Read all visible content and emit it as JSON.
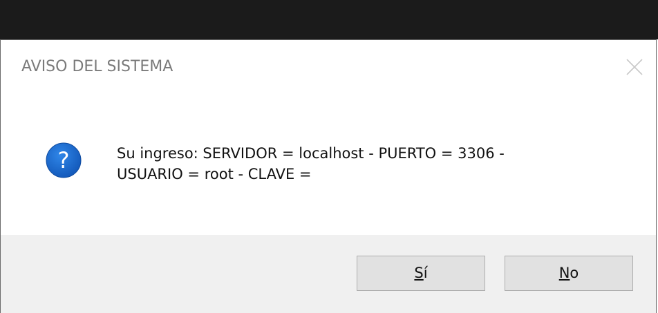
{
  "dialog": {
    "title": "AVISO DEL SISTEMA",
    "close_icon": "close-icon",
    "icon": "question-icon",
    "accent_color": "#1a66c9",
    "message_lines": [
      "Su ingreso: SERVIDOR = localhost - PUERTO = 3306 -",
      "USUARIO = root - CLAVE ="
    ],
    "buttons": {
      "yes": {
        "mnemonic": "S",
        "rest": "í"
      },
      "no": {
        "mnemonic": "N",
        "rest": "o"
      }
    }
  }
}
